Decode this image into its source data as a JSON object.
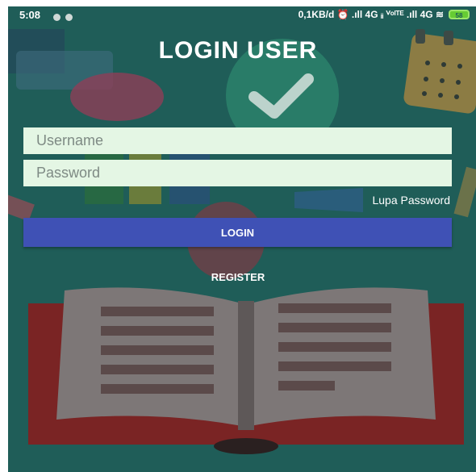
{
  "status_bar": {
    "time": "5:08",
    "network_info": "0,1KB/d ⏰ .ıll 4G ᵢᵢ ⱽᵒˡᵀᴱ .ıll 4G ≋",
    "battery": "58"
  },
  "page_title": "LOGIN USER",
  "form": {
    "username_placeholder": "Username",
    "password_placeholder": "Password",
    "forgot_password_label": "Lupa Password",
    "login_button_label": "LOGIN",
    "register_label": "REGISTER"
  },
  "colors": {
    "background": "#1f5d58",
    "input_background": "#e4f6e4",
    "login_button": "#3f51b5",
    "text_white": "#ffffff"
  },
  "icons": [
    "book-illustration",
    "checkmark-icon",
    "calendar-icon",
    "wifi-icon",
    "alarm-icon",
    "battery-icon"
  ]
}
